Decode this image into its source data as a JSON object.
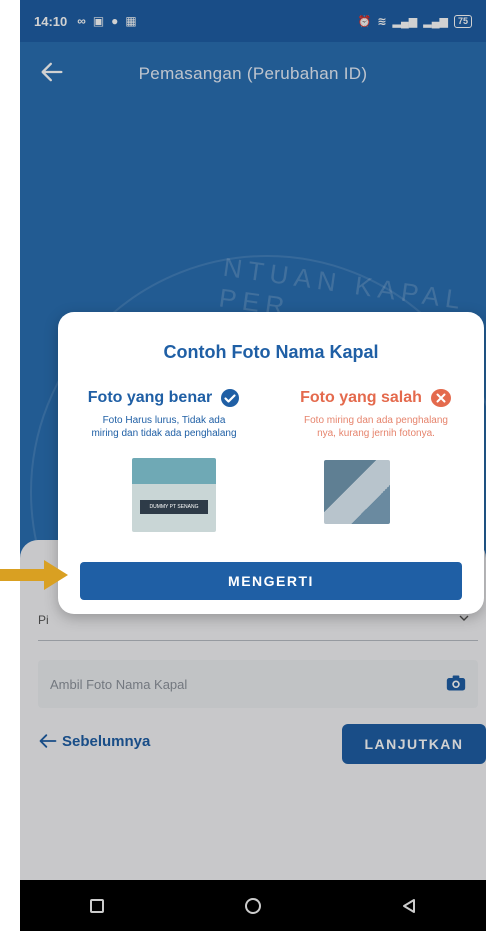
{
  "status_bar": {
    "time": "14:10",
    "battery": "75"
  },
  "app_bar": {
    "title": "Pemasangan (Perubahan ID)"
  },
  "background": {
    "emblem_text": "NTUAN KAPAL PER"
  },
  "dialog": {
    "title": "Contoh Foto Nama Kapal",
    "correct": {
      "heading": "Foto yang benar",
      "description": "Foto Harus lurus, Tidak ada miring dan tidak ada penghalang",
      "plate_text": "DUMMY PT SENANG"
    },
    "wrong": {
      "heading": "Foto yang salah",
      "description": "Foto miring dan ada penghalang nya, kurang jernih fotonya."
    },
    "confirm_label": "MENGERTI"
  },
  "form": {
    "dropdown_text": "Pi",
    "photo_placeholder": "Ambil Foto Nama Kapal",
    "prev_label": "Sebelumnya",
    "next_label": "LANJUTKAN"
  },
  "colors": {
    "primary": "#1f5fa5",
    "background": "#2a6fb3",
    "wrong_accent": "#e46a4d",
    "annotation_arrow": "#d9a022"
  }
}
